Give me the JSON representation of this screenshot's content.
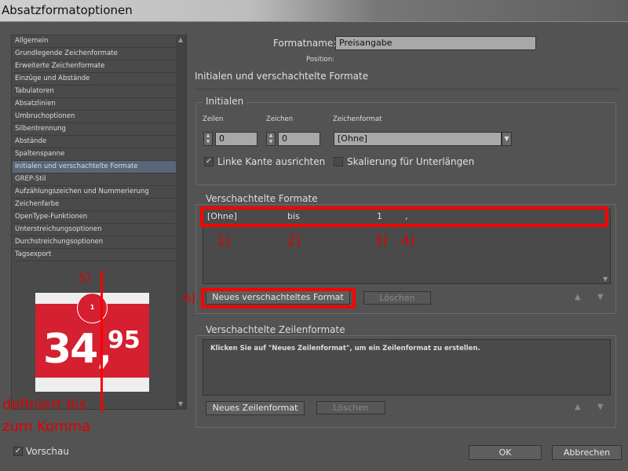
{
  "window": {
    "title": "Absatzformatoptionen"
  },
  "sidebar": {
    "items": [
      "Allgemein",
      "Grundlegende Zeichenformate",
      "Erweiterte Zeichenformate",
      "Einzüge und Abstände",
      "Tabulatoren",
      "Absatzlinien",
      "Umbruchoptionen",
      "Silbentrennung",
      "Abstände",
      "Spaltenspanne",
      "Initialen und verschachtelte Formate",
      "GREP-Stil",
      "Aufzählungszeichen und Nummerierung",
      "Zeichenfarbe",
      "OpenType-Funktionen",
      "Unterstreichungsoptionen",
      "Durchstreichungsoptionen",
      "Tagsexport"
    ],
    "selected": "Initialen und verschachtelte Formate"
  },
  "preview": {
    "badge": "1",
    "price_main": "34",
    "price_comma": ",",
    "price_cents": "95",
    "brand_color": "#d42030"
  },
  "header": {
    "formatname_label": "Formatname:",
    "formatname_value": "Preisangabe",
    "position_label": "Position:",
    "section_title": "Initialen und verschachtelte Formate"
  },
  "initialen": {
    "title": "Initialen",
    "zeilen_label": "Zeilen",
    "zeilen_value": "0",
    "zeichen_label": "Zeichen",
    "zeichen_value": "0",
    "zeichenformat_label": "Zeichenformat",
    "zeichenformat_value": "[Ohne]",
    "linke_kante": "Linke Kante ausrichten",
    "linke_kante_checked": true,
    "skalierung": "Skalierung für Unterlängen",
    "skalierung_checked": false
  },
  "nested": {
    "title": "Verschachtelte Formate",
    "row": {
      "format": "[Ohne]",
      "mode": "bis",
      "count": "1",
      "char": ","
    },
    "new_button": "Neues verschachteltes Format",
    "delete_button": "Löschen"
  },
  "line_formats": {
    "title": "Verschachtelte Zeilenformate",
    "hint": "Klicken Sie auf \"Neues Zeilenformat\", um ein Zeilenformat zu erstellen.",
    "new_button": "Neues Zeilenformat",
    "delete_button": "Löschen"
  },
  "annotations": {
    "a1": "1)",
    "a2": "2)",
    "a3": "3)",
    "a4": "4)",
    "a5": "5)",
    "a6": "6)",
    "note1": "definiert bis",
    "note2": "zum Komma",
    "color": "#ff0000"
  },
  "footer": {
    "preview_label": "Vorschau",
    "preview_checked": true,
    "ok": "OK",
    "cancel": "Abbrechen"
  }
}
